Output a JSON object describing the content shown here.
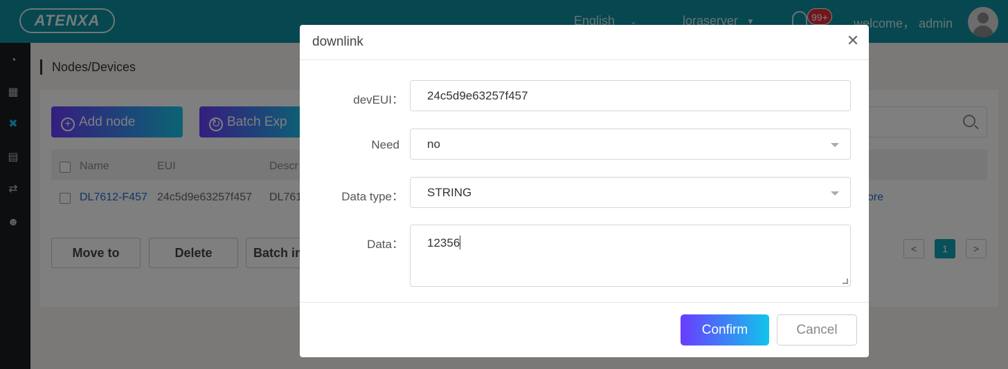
{
  "header": {
    "logo_text": "ATENXA",
    "language": "English",
    "server": "loraserver",
    "notification_count": "99+",
    "welcome": "welcome， admin"
  },
  "sidebar": {
    "icons": [
      "pie-chart-icon",
      "grid-icon",
      "nodes-icon",
      "router-icon",
      "transfer-icon",
      "user-settings-icon"
    ]
  },
  "page": {
    "title": "Nodes/Devices",
    "add_node_label": "Add node",
    "batch_export_label": "Batch Exp",
    "table": {
      "headers": [
        "Name",
        "EUI",
        "Descr"
      ],
      "rows": [
        {
          "name": "DL7612-F457",
          "eui": "24c5d9e63257f457",
          "desc": "DL761",
          "more": "ore"
        }
      ]
    },
    "move_to_label": "Move to",
    "delete_label": "Delete",
    "batch_import_label": "Batch im",
    "pagination": {
      "prev": "<",
      "current": "1",
      "next": ">"
    }
  },
  "modal": {
    "title": "downlink",
    "close": "✕",
    "fields": {
      "deveui_label": "devEUI：",
      "deveui_value": "24c5d9e63257f457",
      "need_label": "Need",
      "need_value": "no",
      "datatype_label": "Data type：",
      "datatype_value": "STRING",
      "data_label": "Data：",
      "data_value": "12356"
    },
    "confirm_label": "Confirm",
    "cancel_label": "Cancel"
  },
  "colors": {
    "header_bg": "#0e8fa0",
    "sidebar_bg": "#191c21",
    "accent_gradient_start": "#6a3cff",
    "accent_gradient_end": "#12c4ec",
    "link": "#1e6bcf"
  }
}
